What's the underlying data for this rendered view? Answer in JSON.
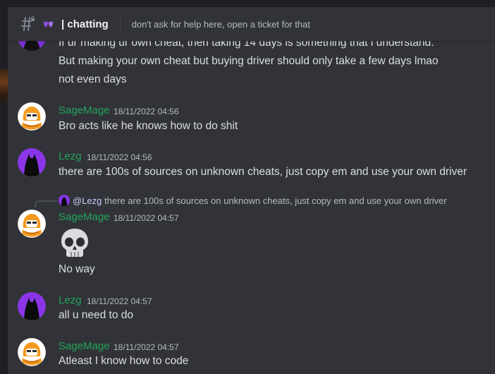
{
  "header": {
    "channel_name": "| chatting",
    "topic": "don't ask for help here, open a ticket for that",
    "icon": "hash-lock-icon",
    "emoji": "purple-hearts-emoji"
  },
  "colors": {
    "background": "#313338",
    "username": "#23a55a",
    "text": "#dbdee1",
    "muted": "#b5bac1"
  },
  "messages": [
    {
      "author": "",
      "lines": [
        "If ur making ur own cheat, then taking 14 days is something that i understand.",
        "But making your own cheat but buying driver should only take a few days lmao",
        "not even days"
      ]
    },
    {
      "author": "SageMage",
      "timestamp": "18/11/2022 04:56",
      "avatar": "sagemage-avatar",
      "lines": [
        "Bro acts like he knows how to do shit"
      ]
    },
    {
      "author": "Lezg",
      "timestamp": "18/11/2022 04:56",
      "avatar": "lezg-avatar",
      "lines": [
        "there are 100s of sources on unknown cheats, just copy em and use your own driver"
      ]
    },
    {
      "author": "SageMage",
      "timestamp": "18/11/2022 04:57",
      "avatar": "sagemage-avatar",
      "reply": {
        "mention": "@Lezg",
        "text": "there are 100s of sources on unknown cheats, just copy em and use your own driver"
      },
      "emoji": "skull-emoji",
      "lines": [
        "No way"
      ]
    },
    {
      "author": "Lezg",
      "timestamp": "18/11/2022 04:57",
      "avatar": "lezg-avatar",
      "lines": [
        "all u need to do"
      ]
    },
    {
      "author": "SageMage",
      "timestamp": "18/11/2022 04:57",
      "avatar": "sagemage-avatar",
      "lines": [
        "Atleast I know how to code"
      ]
    }
  ]
}
